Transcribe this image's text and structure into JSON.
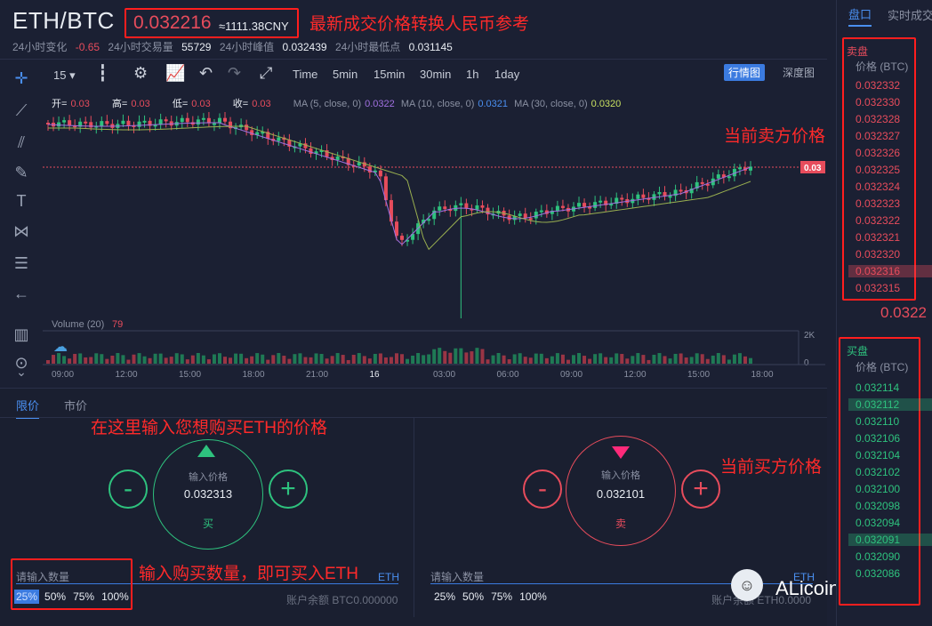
{
  "header": {
    "pair": "ETH/BTC",
    "last_price": "0.032216",
    "cny": "≈1111.38CNY",
    "change_label": "24小时变化",
    "change_value": "-0.65",
    "volume_label": "24小时交易量",
    "volume_value": "55729",
    "high_label": "24小时峰值",
    "high_value": "0.032439",
    "low_label": "24小时最低点",
    "low_value": "0.031145"
  },
  "toolbar": {
    "interval": "15",
    "time_options": [
      "Time",
      "5min",
      "15min",
      "30min",
      "1h",
      "1day"
    ],
    "kline_label": "行情图",
    "depth_label": "深度图"
  },
  "ohlc": {
    "open_label": "开=",
    "open": "0.03",
    "high_label": "高=",
    "high": "0.03",
    "low_label": "低=",
    "low": "0.03",
    "close_label": "收=",
    "close": "0.03",
    "ma5_label": "MA (5, close, 0)",
    "ma5": "0.0322",
    "ma10_label": "MA (10, close, 0)",
    "ma10": "0.0321",
    "ma30_label": "MA (30, close, 0)",
    "ma30": "0.0320"
  },
  "chart": {
    "price_tag": "0.03",
    "volume_label": "Volume (20)",
    "volume_value": "79",
    "vol_axis_top": "2K",
    "vol_axis_bottom": "0",
    "time_ticks": [
      "09:00",
      "12:00",
      "15:00",
      "18:00",
      "21:00",
      "16",
      "03:00",
      "06:00",
      "09:00",
      "12:00",
      "15:00",
      "18:00"
    ]
  },
  "trade": {
    "tab_limit": "限价",
    "tab_market": "市价",
    "buy": {
      "price_label": "输入价格",
      "price": "0.032313",
      "action": "买",
      "qty_placeholder": "请输入数量",
      "unit": "ETH",
      "balance": "账户余额 BTC0.000000"
    },
    "sell": {
      "price_label": "输入价格",
      "price": "0.032101",
      "action": "卖",
      "qty_placeholder": "请输入数量",
      "unit": "ETH",
      "balance": "账户余额 ETH0.0000"
    },
    "percents": [
      "25%",
      "50%",
      "75%",
      "100%"
    ]
  },
  "book": {
    "tab_book": "盘口",
    "tab_trades": "实时成交",
    "asks_label": "卖盘",
    "bids_label": "买盘",
    "price_header": "价格 (BTC)",
    "asks": [
      "0.032332",
      "0.032330",
      "0.032328",
      "0.032327",
      "0.032326",
      "0.032325",
      "0.032324",
      "0.032323",
      "0.032322",
      "0.032321",
      "0.032320",
      "0.032316",
      "0.032315"
    ],
    "last": "0.0322",
    "bids": [
      "0.032114",
      "0.032112",
      "0.032110",
      "0.032106",
      "0.032104",
      "0.032102",
      "0.032100",
      "0.032098",
      "0.032094",
      "0.032091",
      "0.032090",
      "0.032086"
    ]
  },
  "annotations": {
    "a1": "最新成交价格转换人民币参考",
    "a2": "当前卖方价格",
    "a3": "在这里输入您想购买ETH的价格",
    "a4": "当前买方价格",
    "a5": "输入购买数量，即可买入ETH"
  },
  "watermark": "ALicoin资讯",
  "colors": {
    "up": "#2ec27e",
    "down": "#e74c5c",
    "accent": "#3b7be0",
    "annotation": "#ff1e1e"
  }
}
